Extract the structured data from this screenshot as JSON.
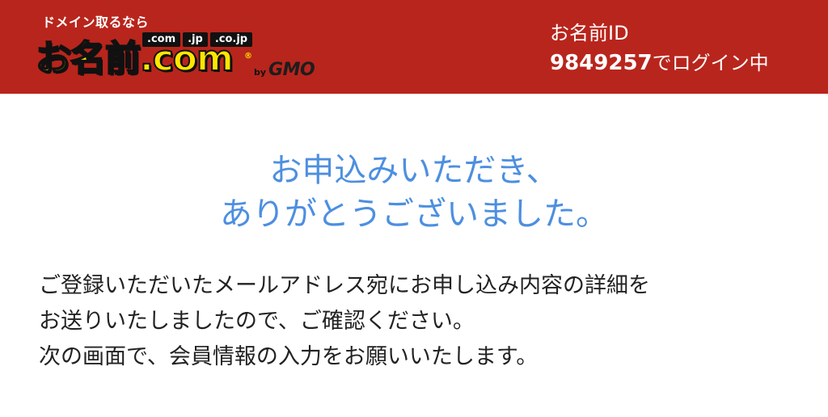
{
  "header": {
    "tagline": "ドメイン取るなら",
    "tlds": [
      ".com",
      ".jp",
      ".co.jp"
    ],
    "brand": "お名前.com",
    "registered_mark": "®",
    "by": "by",
    "company": "GMO",
    "account_label": "お名前ID",
    "account_id": "9849257",
    "login_status_suffix": "でログイン中",
    "background_color": "#b8251c"
  },
  "main": {
    "thanks_line1": "お申込みいただき、",
    "thanks_line2": "ありがとうございました。",
    "thanks_color": "#4d8fe0",
    "message_lines": [
      "ご登録いただいたメールアドレス宛にお申し込み内容の詳細を",
      "お送りいたしましたので、ご確認ください。",
      "次の画面で、会員情報の入力をお願いいたします。"
    ]
  }
}
